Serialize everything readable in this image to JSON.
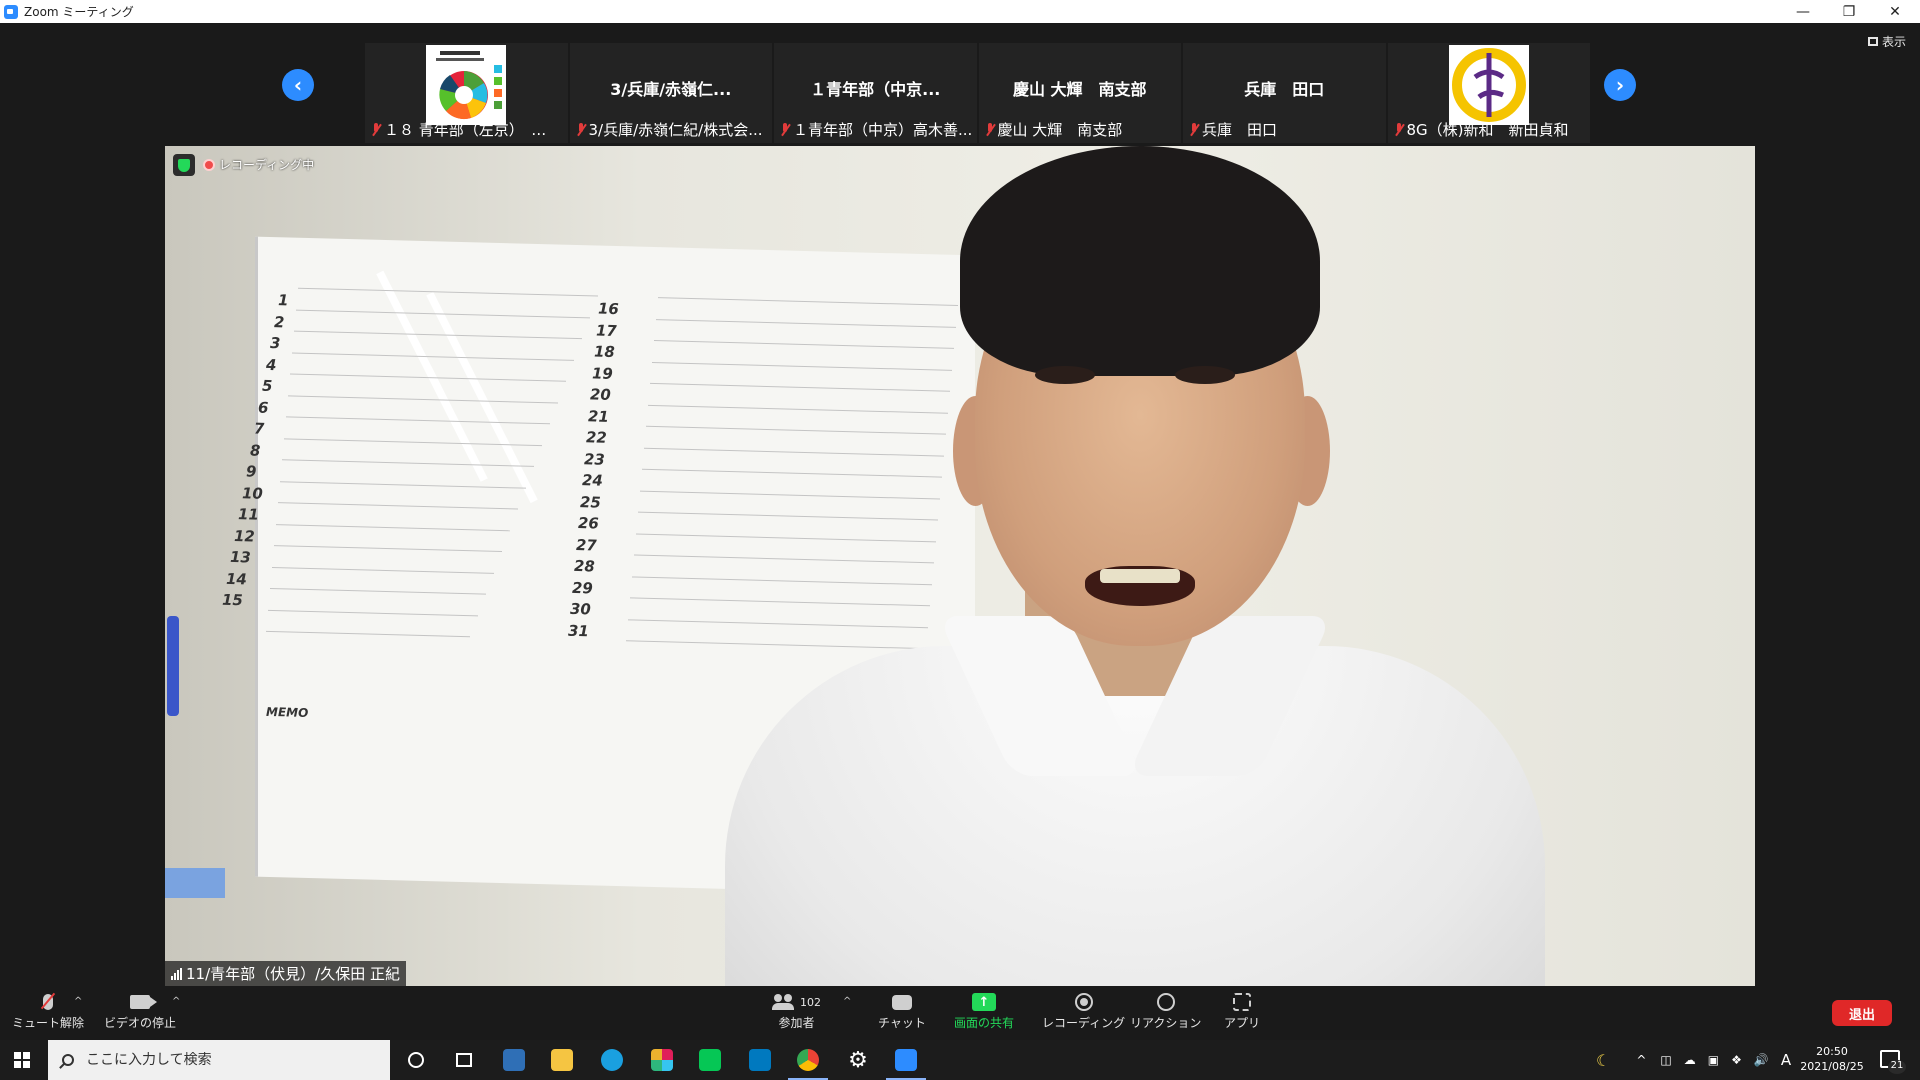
{
  "window": {
    "title": "Zoom ミーティング"
  },
  "view_button": {
    "label": "表示"
  },
  "participants_strip": [
    {
      "big_name": "",
      "label": "１８ 青年部（左京）　…",
      "has_avatar": true
    },
    {
      "big_name": "3/兵庫/赤嶺仁...",
      "label": "3/兵庫/赤嶺仁紀/株式会..."
    },
    {
      "big_name": "１青年部（中京...",
      "label": "１青年部（中京）高木善..."
    },
    {
      "big_name": "慶山 大輝　南支部",
      "label": "慶山 大輝　南支部"
    },
    {
      "big_name": "兵庫　田口",
      "label": "兵庫　田口"
    },
    {
      "big_name": "",
      "label": "8G（株)新和　新田貞和",
      "has_avatar": true
    }
  ],
  "main_video": {
    "recording_label": "レコーディング中",
    "speaker_name": "11/青年部（伏見）/久保田 正紀"
  },
  "whiteboard": {
    "left_numbers": [
      "1",
      "2",
      "3",
      "4",
      "5",
      "6",
      "7",
      "8",
      "9",
      "10",
      "11",
      "12",
      "13",
      "14",
      "15"
    ],
    "right_numbers": [
      "16",
      "17",
      "18",
      "19",
      "20",
      "21",
      "22",
      "23",
      "24",
      "25",
      "26",
      "27",
      "28",
      "29",
      "30",
      "31"
    ],
    "memo": "MEMO"
  },
  "toolbar": {
    "mute_label": "ミュート解除",
    "video_label": "ビデオの停止",
    "participants_label": "参加者",
    "participants_count": "102",
    "chat_label": "チャット",
    "share_label": "画面の共有",
    "record_label": "レコーディング",
    "reaction_label": "リアクション",
    "apps_label": "アプリ",
    "leave_label": "退出"
  },
  "taskbar": {
    "search_placeholder": "ここに入力して検索",
    "ime_indicator": "A",
    "time": "20:50",
    "date": "2021/08/25",
    "notification_count": "21"
  },
  "colors": {
    "zoom_blue": "#2d8cff",
    "share_green": "#23d959",
    "leave_red": "#e02828",
    "muted_red": "#e23b3b"
  }
}
